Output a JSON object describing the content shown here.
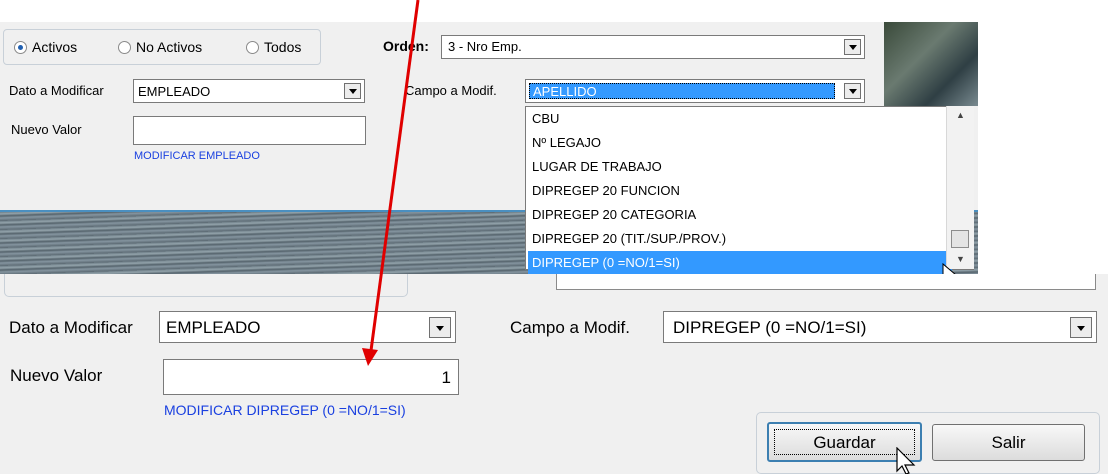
{
  "top": {
    "filters": [
      "Activos",
      "No Activos",
      "Todos"
    ],
    "orden_label": "Orden:",
    "orden_value": "3  - Nro Emp.",
    "dato_label": "Dato a Modificar",
    "dato_value": "EMPLEADO",
    "campo_label": "Campo a Modif.",
    "campo_value": "APELLIDO",
    "nuevo_label": "Nuevo Valor",
    "nuevo_value": "",
    "link": "MODIFICAR EMPLEADO",
    "dropdown_options": [
      "CBU",
      "Nº LEGAJO",
      "LUGAR DE TRABAJO",
      "DIPREGEP 20 FUNCION",
      "DIPREGEP 20 CATEGORIA",
      "DIPREGEP 20 (TIT./SUP./PROV.)",
      "DIPREGEP (0 =NO/1=SI)"
    ]
  },
  "bottom": {
    "dato_label": "Dato a Modificar",
    "dato_value": "EMPLEADO",
    "campo_label": "Campo a Modif.",
    "campo_value": "DIPREGEP (0 =NO/1=SI)",
    "nuevo_label": "Nuevo Valor",
    "nuevo_value": "1",
    "link": "MODIFICAR DIPREGEP (0 =NO/1=SI)",
    "save_label": "Guardar",
    "exit_label": "Salir"
  },
  "colors": {
    "annotation_arrow": "#e00000",
    "highlight": "#3399ff",
    "link": "#1a40e0"
  }
}
